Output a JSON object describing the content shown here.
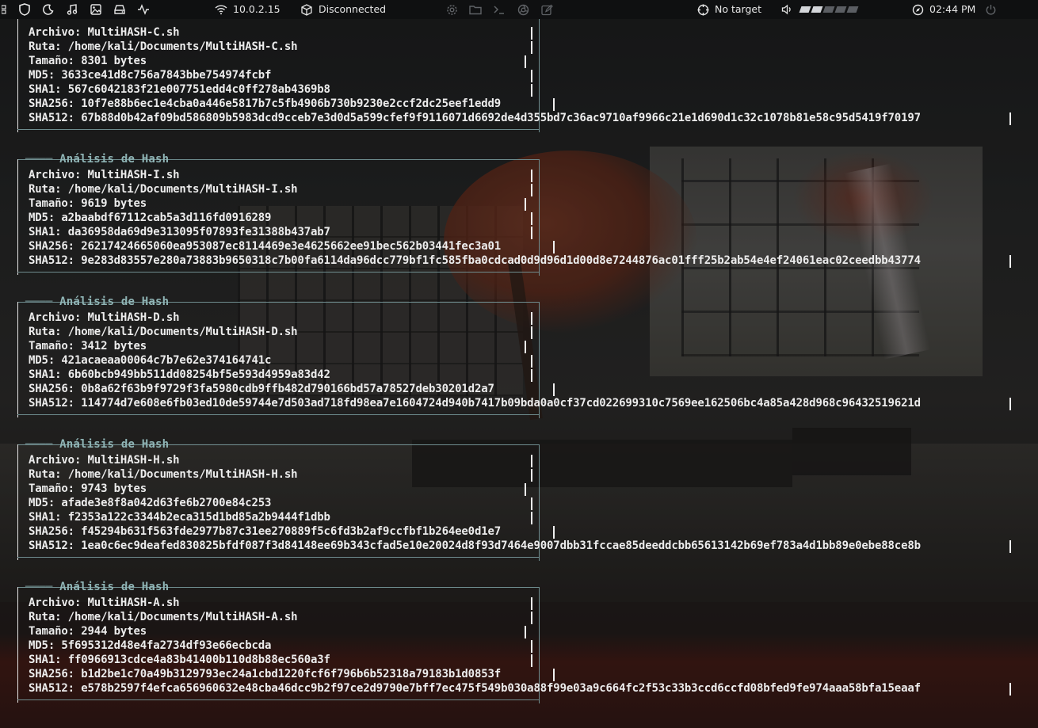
{
  "topbar": {
    "ip": "10.0.2.15",
    "vpn_status": "Disconnected",
    "target": "No target",
    "volume_level": 0.4,
    "clock": "02:44 PM"
  },
  "box_title": "Análisis de Hash",
  "labels": {
    "archivo": "Archivo:",
    "ruta": "Ruta:",
    "tamano": "Tamaño:",
    "md5": "MD5:",
    "sha1": "SHA1:",
    "sha256": "SHA256:",
    "sha512": "SHA512:"
  },
  "analyses": [
    {
      "archivo": "MultiHASH-C.sh",
      "ruta": "/home/kali/Documents/MultiHASH-C.sh",
      "tamano": "8301 bytes",
      "md5": "3633ce41d8c756a7843bbe754974fcbf",
      "sha1": "567c6042183f21e007751edd4c0ff278ab4369b8",
      "sha256": "10f7e88b6ec1e4cba0a446e5817b7c5fb4906b730b9230e2ccf2dc25eef1edd9",
      "sha512": "67b88d0b42af09bd586809b5983dcd9cceb7e3d0d5a599cfef9f9116071d6692de4d355bd7c36ac9710af9966c21e1d690d1c32c1078b81e58c95d5419f70197"
    },
    {
      "archivo": "MultiHASH-I.sh",
      "ruta": "/home/kali/Documents/MultiHASH-I.sh",
      "tamano": "9619 bytes",
      "md5": "a2baabdf67112cab5a3d116fd0916289",
      "sha1": "da36958da69d9e313095f07893fe31388b437ab7",
      "sha256": "26217424665060ea953087ec8114469e3e4625662ee91bec562b03441fec3a01",
      "sha512": "9e283d83557e280a73883b9650318c7b00fa6114da96dcc779bf1fc585fba0cdcad0d9d96d1d00d8e7244876ac01fff25b2ab54e4ef24061eac02ceedbb43774"
    },
    {
      "archivo": "MultiHASH-D.sh",
      "ruta": "/home/kali/Documents/MultiHASH-D.sh",
      "tamano": "3412 bytes",
      "md5": "421acaeaa00064c7b7e62e374164741c",
      "sha1": "6b60bcb949bb511dd08254bf5e593d4959a83d42",
      "sha256": "0b8a62f63b9f9729f3fa5980cdb9ffb482d790166bd57a78527deb30201d2a7",
      "sha512": "114774d7e608e6fb03ed10de59744e7d503ad718fd98ea7e1604724d940b7417b09bda0a0cf37cd022699310c7569ee162506bc4a85a428d968c96432519621d"
    },
    {
      "archivo": "MultiHASH-H.sh",
      "ruta": "/home/kali/Documents/MultiHASH-H.sh",
      "tamano": "9743 bytes",
      "md5": "afade3e8f8a042d63fe6b2700e84c253",
      "sha1": "f2353a122c3344b2eca315d1bd85a2b9444f1dbb",
      "sha256": "f45294b631f563fde2977b87c31ee270889f5c6fd3b2af9ccfbf1b264ee0d1e7",
      "sha512": "1ea0c6ec9deafed830825bfdf087f3d84148ee69b343cfad5e10e20024d8f93d7464e9007dbb31fccae85deeddcbb65613142b69ef783a4d1bb89e0ebe88ce8b"
    },
    {
      "archivo": "MultiHASH-A.sh",
      "ruta": "/home/kali/Documents/MultiHASH-A.sh",
      "tamano": "2944 bytes",
      "md5": "5f695312d48e4fa2734df93e66ecbcda",
      "sha1": "ff0966913cdce4a83b41400b110d8b88ec560a3f",
      "sha256": "b1d2be1c70a49b3129793ec24a1cbd1220fcf6f796b6b52318a79183b1d0853f",
      "sha512": "e578b2597f4efca656960632e48cba46dcc9b2f97ce2d9790e7bff7ec475f549b030a88f99e03a9c664fc2f53c33b3ccd6ccfd08bfed9fe974aaa58bfa15eaaf"
    }
  ]
}
